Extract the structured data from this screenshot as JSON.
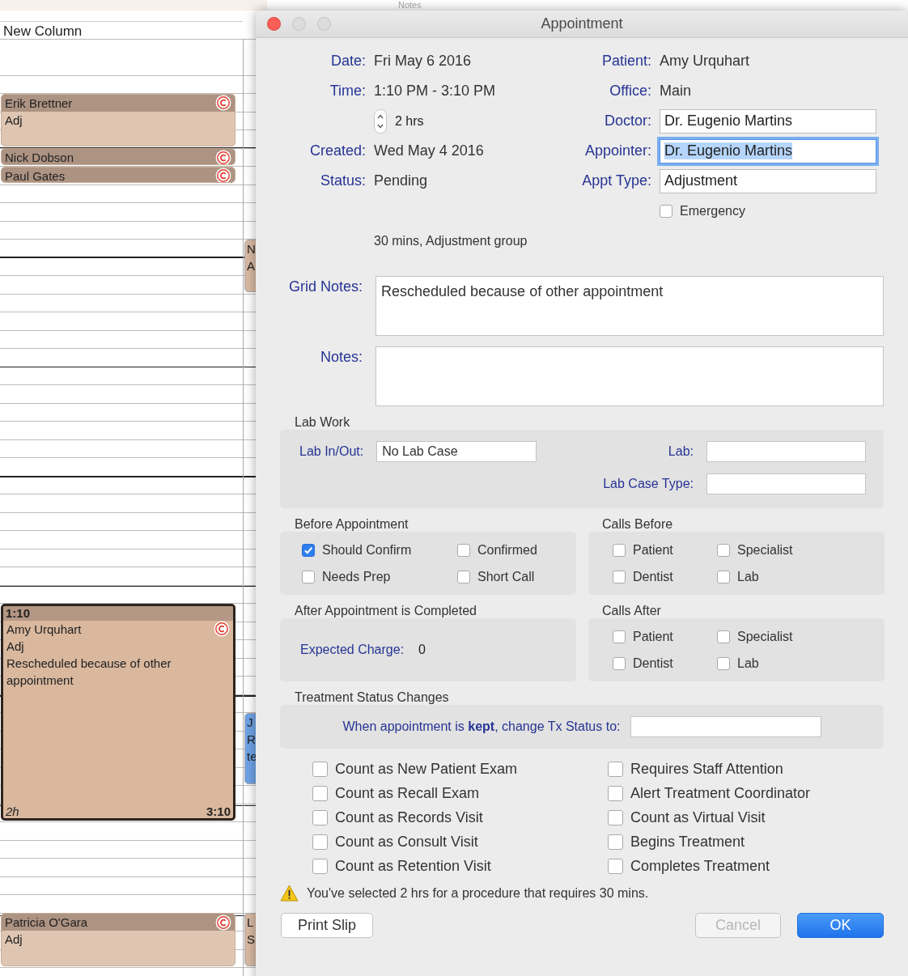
{
  "calendar": {
    "cut_header": "Notes",
    "column_header": "New Column",
    "events": [
      {
        "title": "Erik Brettner",
        "lines": [
          "Adj"
        ],
        "flag": true,
        "selected": false
      },
      {
        "title": "Nick Dobson",
        "flag": true,
        "selected": false
      },
      {
        "title": "Paul Gates",
        "flag": true,
        "selected": false
      },
      {
        "time": "1:10",
        "title": "Amy Urquhart",
        "lines": [
          "Adj",
          "Rescheduled because of other appointment"
        ],
        "flag": true,
        "duration": "2h",
        "end_time": "3:10",
        "selected": true
      },
      {
        "title": "Patricia O'Gara",
        "lines": [
          "Adj"
        ],
        "flag": true,
        "selected": false
      }
    ],
    "side_events": [
      {
        "lines": [
          "N",
          "A"
        ],
        "color": "#d8b9a3"
      },
      {
        "lines": [
          "J",
          "R",
          "te"
        ],
        "color": "#6fa3e6"
      },
      {
        "lines": [
          "L",
          "S"
        ],
        "color": "#d8b9a3"
      }
    ]
  },
  "dialog": {
    "title": "Appointment",
    "details_left": [
      {
        "kind": "text",
        "label": "Date:",
        "value": "Fri May 6 2016"
      },
      {
        "kind": "text",
        "label": "Time:",
        "value": "1:10 PM - 3:10 PM"
      },
      {
        "kind": "stepper",
        "value": "2 hrs"
      },
      {
        "kind": "text",
        "label": "Created:",
        "value": "Wed May 4 2016"
      },
      {
        "kind": "text",
        "label": "Status:",
        "value": "Pending"
      }
    ],
    "details_right": [
      {
        "kind": "text",
        "label": "Patient:",
        "value": "Amy Urquhart"
      },
      {
        "kind": "text",
        "label": "Office:",
        "value": "Main"
      },
      {
        "kind": "field",
        "label": "Doctor:",
        "value": "Dr. Eugenio Martins",
        "focused": false
      },
      {
        "kind": "field",
        "label": "Appointer:",
        "value": "Dr. Eugenio Martins",
        "focused": true
      },
      {
        "kind": "field",
        "label": "Appt Type:",
        "value": "Adjustment",
        "focused": false
      },
      {
        "kind": "checkbox",
        "label": "Emergency",
        "checked": false
      }
    ],
    "procedure_note": "30 mins, Adjustment group",
    "notes": [
      {
        "label": "Grid Notes:",
        "value": "Rescheduled because of other appointment"
      },
      {
        "label": "Notes:"
      }
    ],
    "lab_work": {
      "title": "Lab Work",
      "in_out_label": "Lab In/Out:",
      "in_out": "No Lab Case",
      "lab_label": "Lab:",
      "case_type_label": "Lab Case Type:"
    },
    "before": {
      "title": "Before Appointment",
      "items": [
        {
          "label": "Should Confirm",
          "checked": true
        },
        {
          "label": "Confirmed",
          "checked": false
        },
        {
          "label": "Needs Prep",
          "checked": false
        },
        {
          "label": "Short Call",
          "checked": false
        }
      ]
    },
    "calls_before": {
      "title": "Calls Before",
      "items": [
        {
          "label": "Patient",
          "checked": false
        },
        {
          "label": "Specialist",
          "checked": false
        },
        {
          "label": "Dentist",
          "checked": false
        },
        {
          "label": "Lab",
          "checked": false
        }
      ]
    },
    "after": {
      "title": "After Appointment is Completed",
      "charge_label": "Expected Charge:",
      "charge": "0"
    },
    "calls_after": {
      "title": "Calls After",
      "items": [
        {
          "label": "Patient",
          "checked": false
        },
        {
          "label": "Specialist",
          "checked": false
        },
        {
          "label": "Dentist",
          "checked": false
        },
        {
          "label": "Lab",
          "checked": false
        }
      ]
    },
    "treatment": {
      "title": "Treatment Status Changes",
      "prompt": "When appointment is **kept**, change Tx Status to:"
    },
    "counts": [
      {
        "label": "Count as New Patient Exam",
        "checked": false
      },
      {
        "label": "Requires Staff Attention",
        "checked": false
      },
      {
        "label": "Count as Recall Exam",
        "checked": false
      },
      {
        "label": "Alert Treatment Coordinator",
        "checked": false
      },
      {
        "label": "Count as Records Visit",
        "checked": false
      },
      {
        "label": "Count as Virtual Visit",
        "checked": false
      },
      {
        "label": "Count as Consult Visit",
        "checked": false
      },
      {
        "label": "Begins Treatment",
        "checked": false
      },
      {
        "label": "Count as Retention Visit",
        "checked": false
      },
      {
        "label": "Completes Treatment",
        "checked": false
      }
    ],
    "warning": "You've selected 2 hrs for a procedure that requires 30 mins.",
    "buttons": [
      {
        "kind": "plain",
        "label": "Print Slip",
        "disabled": false
      },
      {
        "kind": "plain",
        "label": "Cancel",
        "disabled": true
      },
      {
        "kind": "default",
        "label": "OK",
        "disabled": false
      }
    ]
  }
}
